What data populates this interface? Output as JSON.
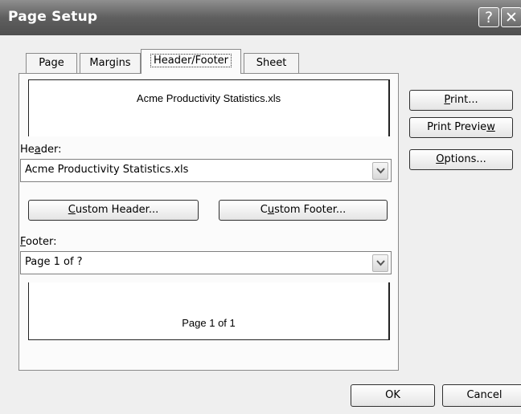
{
  "window": {
    "title": "Page Setup",
    "help_glyph": "?",
    "close_glyph": "✕"
  },
  "tabs": [
    {
      "label": "Page"
    },
    {
      "label": "Margins"
    },
    {
      "label": "Header/Footer"
    },
    {
      "label": "Sheet"
    }
  ],
  "header_preview": {
    "text": "Acme Productivity Statistics.xls"
  },
  "header_field": {
    "label_pre": "He",
    "label_key": "a",
    "label_post": "der:",
    "value": "Acme Productivity Statistics.xls"
  },
  "custom_header": {
    "pre": "",
    "key": "C",
    "post": "ustom Header..."
  },
  "custom_footer": {
    "pre": "C",
    "key": "u",
    "post": "stom Footer..."
  },
  "footer_field": {
    "label_pre": "",
    "label_key": "F",
    "label_post": "ooter:",
    "value": "Page 1 of ?"
  },
  "footer_preview": {
    "text": "Page 1 of 1"
  },
  "side_buttons": {
    "print": {
      "pre": "",
      "key": "P",
      "post": "rint..."
    },
    "print_preview": {
      "pre": "Print Previe",
      "key": "w",
      "post": ""
    },
    "options": {
      "pre": "",
      "key": "O",
      "post": "ptions..."
    }
  },
  "footer_buttons": {
    "ok": "OK",
    "cancel": "Cancel"
  }
}
